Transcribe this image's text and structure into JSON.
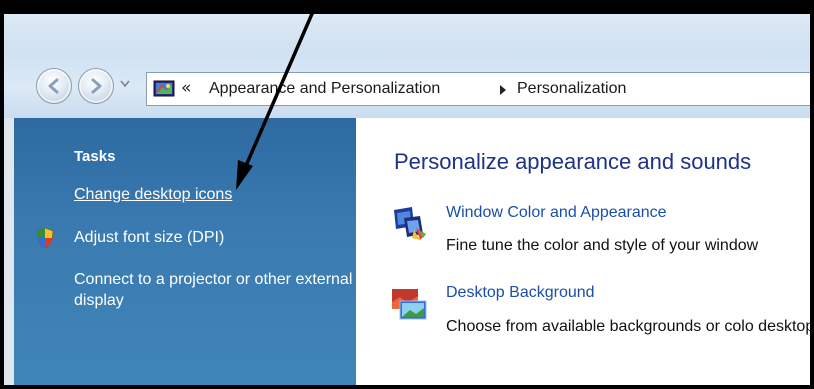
{
  "window": {
    "colors": {
      "frame": "#000000",
      "sidebar": "#3a7ab0",
      "link": "#1a4fa8",
      "heading": "#1e3287"
    }
  },
  "nav": {
    "back_icon": "back-arrow-icon",
    "forward_icon": "forward-arrow-icon",
    "recent_icon": "dropdown-icon"
  },
  "address": {
    "icon": "control-panel-icon",
    "overflow": "«",
    "crumbs": [
      "Appearance and Personalization",
      "Personalization"
    ]
  },
  "sidebar": {
    "heading": "Tasks",
    "items": [
      {
        "label": "Change desktop icons",
        "icon": ""
      },
      {
        "label": "Adjust font size (DPI)",
        "icon": "shield-icon"
      },
      {
        "label": "Connect to a projector or other external display",
        "icon": ""
      }
    ]
  },
  "main": {
    "title": "Personalize appearance and sounds",
    "items": [
      {
        "link": "Window Color and Appearance",
        "description": "Fine tune the color and style of your window",
        "icon": "window-color-icon"
      },
      {
        "link": "Desktop Background",
        "description": "Choose from available backgrounds or colo desktop.",
        "icon": "desktop-background-icon"
      }
    ]
  },
  "annotation": {
    "icon": "pointer-arrow-icon"
  }
}
